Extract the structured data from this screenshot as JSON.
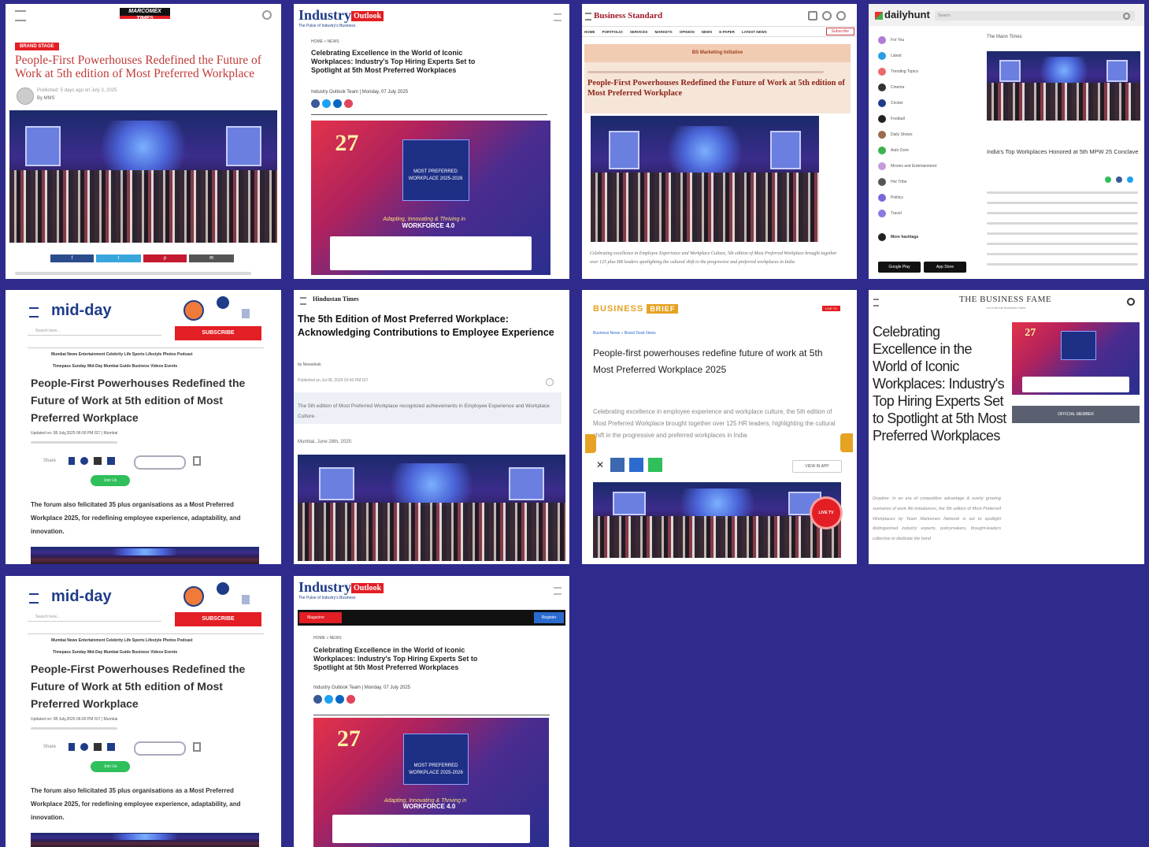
{
  "colors": {
    "background": "#2e2b8c",
    "accent_red": "#e31e24",
    "accent_blue": "#1f5fbd",
    "middayblue": "#1f3c88"
  },
  "c1": {
    "brand": "MARCOMEX TIMES",
    "badge": "BRAND STAGE",
    "title": "People-First Powerhouses Redefined the Future of Work at 5th edition of Most Preferred Workplace",
    "byline": "Published: 5 days ago on July 3, 2025",
    "author": "By MMS",
    "share": [
      "f",
      "t",
      "p",
      "✉"
    ]
  },
  "c2": {
    "brand": "Industry",
    "brand2": "Outlook",
    "tagline": "The Pulse of Industry's Business",
    "crumb": "HOME » NEWS",
    "title": "Celebrating Excellence in the World of Iconic Workplaces: Industry's Top Hiring Experts Set to Spotlight at 5th Most Preferred Workplaces",
    "meta": "Industry Outlook Team | Monday, 07 July 2025",
    "poster": {
      "big": "27",
      "mpw": "MOST PREFERRED WORKPLACE 2025-2026",
      "tag": "Adapting, Innovating & Thriving in",
      "wf": "WORKFORCE 4.0"
    }
  },
  "c3": {
    "brand": "Business Standard",
    "nav": [
      "HOME",
      "PORTFOLIO",
      "SERVICES",
      "MARKETS",
      "OPINION",
      "NEWS",
      "E-PAPER",
      "LATEST NEWS"
    ],
    "subscribe": "Subscribe",
    "sponsor": "BS Marketing Initiative",
    "title": "People-First Powerhouses Redefined the Future of Work at 5th edition of Most Preferred Workplace",
    "caption": "Celebrating excellence in Employee Experience and Workplace Culture, 5th edition of Most Preferred Workplace brought together over 125 plus HR leaders spotlighting the cultural shift to the progressive and preferred workplaces in India"
  },
  "c4": {
    "brand": "dailyhunt",
    "search": "Search",
    "menu": [
      "For You",
      "Latest",
      "Trending Topics",
      "Cinema",
      "Cricket",
      "Football",
      "Daily Shows",
      "Auto Zone",
      "Movies and Entertainment",
      "Her Tribe",
      "Politics",
      "Travel"
    ],
    "more": "More hashtags",
    "source": "The Mann Times",
    "title": "India's Top Workplaces Honored at 5th MPW 25 Conclave",
    "play": "Google Play",
    "apple": "App Store"
  },
  "c5": {
    "brand": "mid-day",
    "search": "Search here...",
    "subscribe": "SUBSCRIBE",
    "nav": "Mumbai  News  Entertainment  Celebrity Life  Sports  Lifestyle  Photos  Podcast",
    "nav2": "Timepass  Sunday Mid-Day  Mumbai Guide  Business  Videos  Events",
    "title": "People-First Powerhouses Redefined the Future of Work at 5th edition of Most Preferred Workplace",
    "updated": "Updated on: 08 July,2025 06:00 PM IST | Mumbai",
    "share": "Share",
    "join": "Join Us",
    "body": "The forum also felicitated 35 plus organisations as a Most Preferred Workplace 2025, for redefining employee experience, adaptability, and innovation."
  },
  "c6": {
    "brand": "Hindustan Times",
    "title": "The 5th Edition of Most Preferred Workplace: Acknowledging Contributions to Employee Experience",
    "author": "by Newsdesk",
    "published": "Published on Jul 08, 2025 03:40 PM IST",
    "summary": "The 5th edition of Most Preferred Workplace recognized achievements in Employee Experience and Workplace Culture.",
    "dateline": "Mumbai, June 28th, 2025:"
  },
  "c7": {
    "brand": "BUSINESS",
    "brand2": "BRIEF",
    "live": "LIVE TV",
    "crumb": "Business News  » Brand Desk News",
    "title": "People-first powerhouses redefine future of work at 5th Most Preferred Workplace 2025",
    "body": "Celebrating excellence in employee experience and workplace culture, the 5th edition of Most Preferred Workplace brought together over 125 HR leaders, highlighting the cultural shift in the progressive and preferred workplaces in India",
    "viewapp": "VIEW IN APP",
    "livebadge": "LIVE TV"
  },
  "c8": {
    "brand": "THE BUSINESS FAME",
    "tagline": "Let it be the Business Fame",
    "title": "Celebrating Excellence in the World of Iconic Workplaces: Industry's Top Hiring Experts Set to Spotlight at 5th Most Preferred Workplaces",
    "member": "OFFICIAL MEMBER",
    "body": "Dropline: In an era of competitive advantage & overly growing scenarios of work life imbalances, the 5th edition of Most Preferred Workplaces by Team Marksmen Network is set to spotlight distinguished industry experts, policymakers, thought-leaders collective to dedicate the bond"
  },
  "c9": {
    "brand": "mid-day",
    "search": "Search here...",
    "subscribe": "SUBSCRIBE",
    "nav": "Mumbai  News  Entertainment  Celebrity Life  Sports  Lifestyle  Photos  Podcast",
    "nav2": "Timepass  Sunday Mid-Day  Mumbai Guide  Business  Videos  Events",
    "title": "People-First Powerhouses Redefined the Future of Work at 5th edition of Most Preferred Workplace",
    "updated": "Updated on: 08 July,2025 06:00 PM IST | Mumbai",
    "share": "Share",
    "join": "Join Us",
    "body": "The forum also felicitated 35 plus organisations as a Most Preferred Workplace 2025, for redefining employee experience, adaptability, and innovation."
  },
  "c10": {
    "brand": "Industry",
    "brand2": "Outlook",
    "tagline": "The Pulse of Industry's Business",
    "nav": "Magazine",
    "register": "Register",
    "crumb": "HOME » NEWS",
    "title": "Celebrating Excellence in the World of Iconic Workplaces: Industry's Top Hiring Experts Set to Spotlight at 5th Most Preferred Workplaces",
    "meta": "Industry Outlook Team | Monday, 07 July 2025",
    "poster": {
      "big": "27",
      "mpw": "MOST PREFERRED WORKPLACE 2025-2026",
      "tag": "Adapting, Innovating & Thriving in",
      "wf": "WORKFORCE 4.0"
    }
  }
}
